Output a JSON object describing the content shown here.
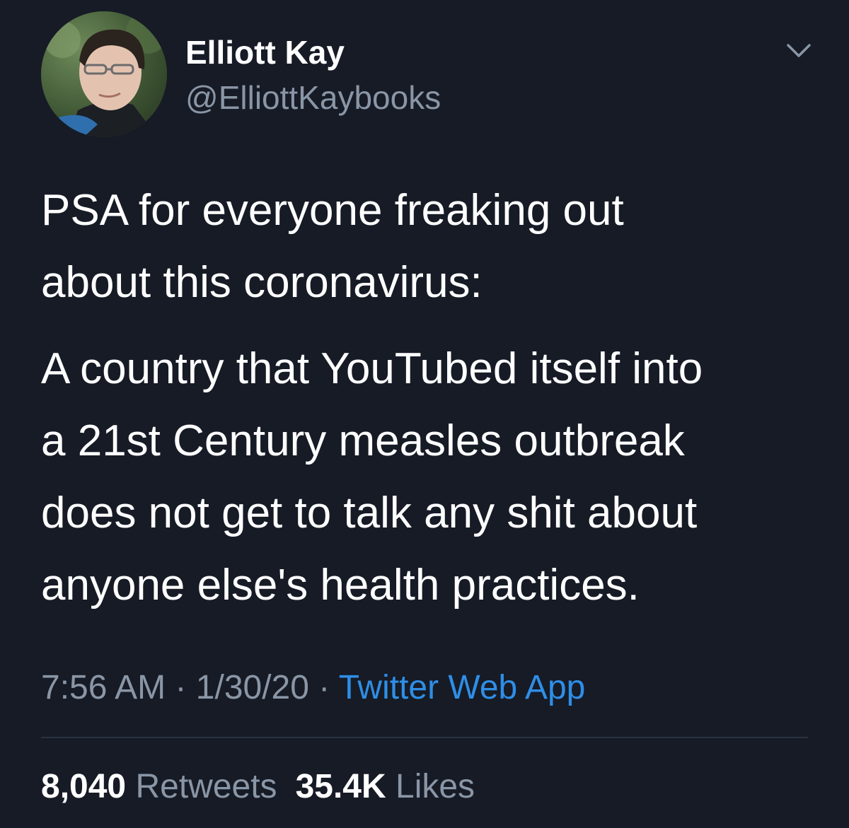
{
  "author": {
    "name": "Elliott Kay",
    "handle": "@ElliottKaybooks"
  },
  "tweet": {
    "paragraph_1": "PSA for everyone freaking out\nabout this coronavirus:",
    "paragraph_2": "A country that YouTubed itself into\na 21st Century measles outbreak\ndoes not get to talk any shit about\nanyone else's health practices."
  },
  "meta": {
    "time": "7:56 AM",
    "separator": "·",
    "date": "1/30/20",
    "source": "Twitter Web App"
  },
  "stats": {
    "retweets_count": "8,040",
    "retweets_label": "Retweets",
    "likes_count": "35.4K",
    "likes_label": "Likes"
  },
  "icons": {
    "menu": "chevron-down-icon",
    "avatar": "avatar"
  },
  "colors": {
    "background": "#161b26",
    "text": "#ffffff",
    "secondary": "#8a96a6",
    "link": "#2f8ee6",
    "divider": "#2b3340"
  }
}
